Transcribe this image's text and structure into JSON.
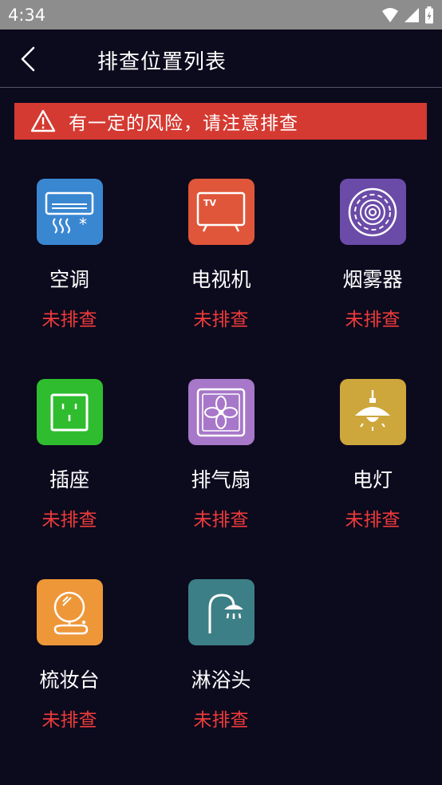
{
  "status_bar": {
    "time": "4:34"
  },
  "header": {
    "title": "排查位置列表"
  },
  "warning": {
    "text": "有一定的风险，请注意排查"
  },
  "items": [
    {
      "name": "空调",
      "status": "未排查",
      "icon": "air-conditioner-icon",
      "color": "#3a87d1"
    },
    {
      "name": "电视机",
      "status": "未排查",
      "icon": "tv-icon",
      "color": "#e0563a"
    },
    {
      "name": "烟雾器",
      "status": "未排查",
      "icon": "smoke-detector-icon",
      "color": "#6b4ba8"
    },
    {
      "name": "插座",
      "status": "未排查",
      "icon": "socket-icon",
      "color": "#2fbd2f"
    },
    {
      "name": "排气扇",
      "status": "未排查",
      "icon": "exhaust-fan-icon",
      "color": "#a777c9"
    },
    {
      "name": "电灯",
      "status": "未排查",
      "icon": "lamp-icon",
      "color": "#cda63c"
    },
    {
      "name": "梳妆台",
      "status": "未排查",
      "icon": "dresser-icon",
      "color": "#ee9738"
    },
    {
      "name": "淋浴头",
      "status": "未排查",
      "icon": "shower-icon",
      "color": "#3c7f86"
    }
  ]
}
